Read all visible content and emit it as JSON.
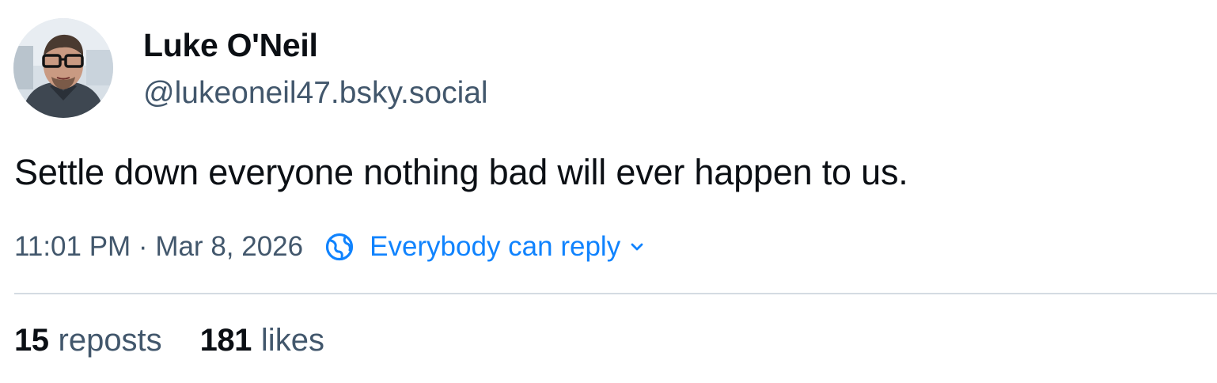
{
  "author": {
    "display_name": "Luke O'Neil",
    "handle": "@lukeoneil47.bsky.social",
    "avatar_icon": "user-avatar-photo"
  },
  "post": {
    "text": "Settle down everyone nothing bad will ever happen to us.",
    "timestamp": "11:01 PM · Mar 8, 2026",
    "reply_setting": {
      "label": "Everybody can reply",
      "icon": "globe-icon",
      "chevron_icon": "chevron-down-icon"
    }
  },
  "stats": {
    "reposts": {
      "count": "15",
      "label": "reposts"
    },
    "likes": {
      "count": "181",
      "label": "likes"
    }
  },
  "colors": {
    "text_primary": "#0b0f14",
    "text_secondary": "#42576c",
    "accent": "#1083fe",
    "divider": "#d4dbe2"
  }
}
